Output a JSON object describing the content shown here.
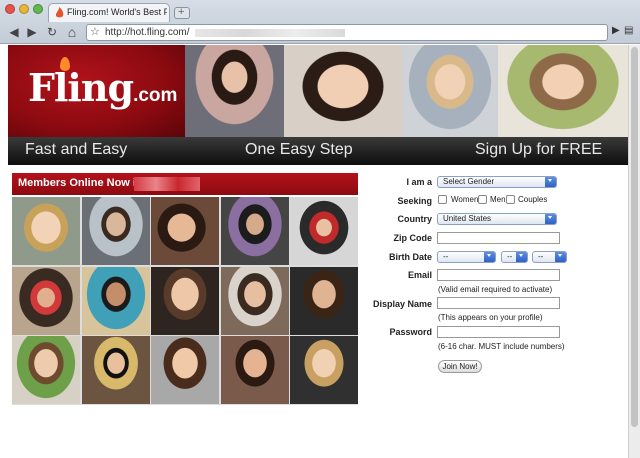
{
  "browser": {
    "tab_title": "Fling.com! World's Best Perso",
    "url_text": "http://hot.fling.com/",
    "buttons": {
      "back": "◀",
      "forward": "▶",
      "reload": "↻",
      "home": "⌂",
      "star": "☆",
      "go": "▶",
      "page": "▤"
    }
  },
  "banner": {
    "logo_text": "Fling",
    "logo_suffix": ".com",
    "taglines": [
      "Fast and Easy",
      "One Easy Step",
      "Sign Up for FREE"
    ]
  },
  "members": {
    "title": "Members Online Now in"
  },
  "form": {
    "i_am_label": "I am a",
    "i_am_value": "Select Gender",
    "seeking_label": "Seeking",
    "seeking_options": [
      "Women",
      "Men",
      "Couples"
    ],
    "country_label": "Country",
    "country_value": "United States",
    "zip_label": "Zip Code",
    "birth_label": "Birth Date",
    "birth_month": "--",
    "birth_day": "--",
    "birth_year": "--",
    "email_label": "Email",
    "email_hint": "(Valid email required to activate)",
    "display_label": "Display Name",
    "display_hint": "(This appears on your profile)",
    "password_label": "Password",
    "password_hint": "(6-16 char. MUST include numbers)",
    "join_label": "Join Now!"
  },
  "colors": {
    "brand_red": "#b3121b",
    "select_blue": "#2e62c4"
  }
}
